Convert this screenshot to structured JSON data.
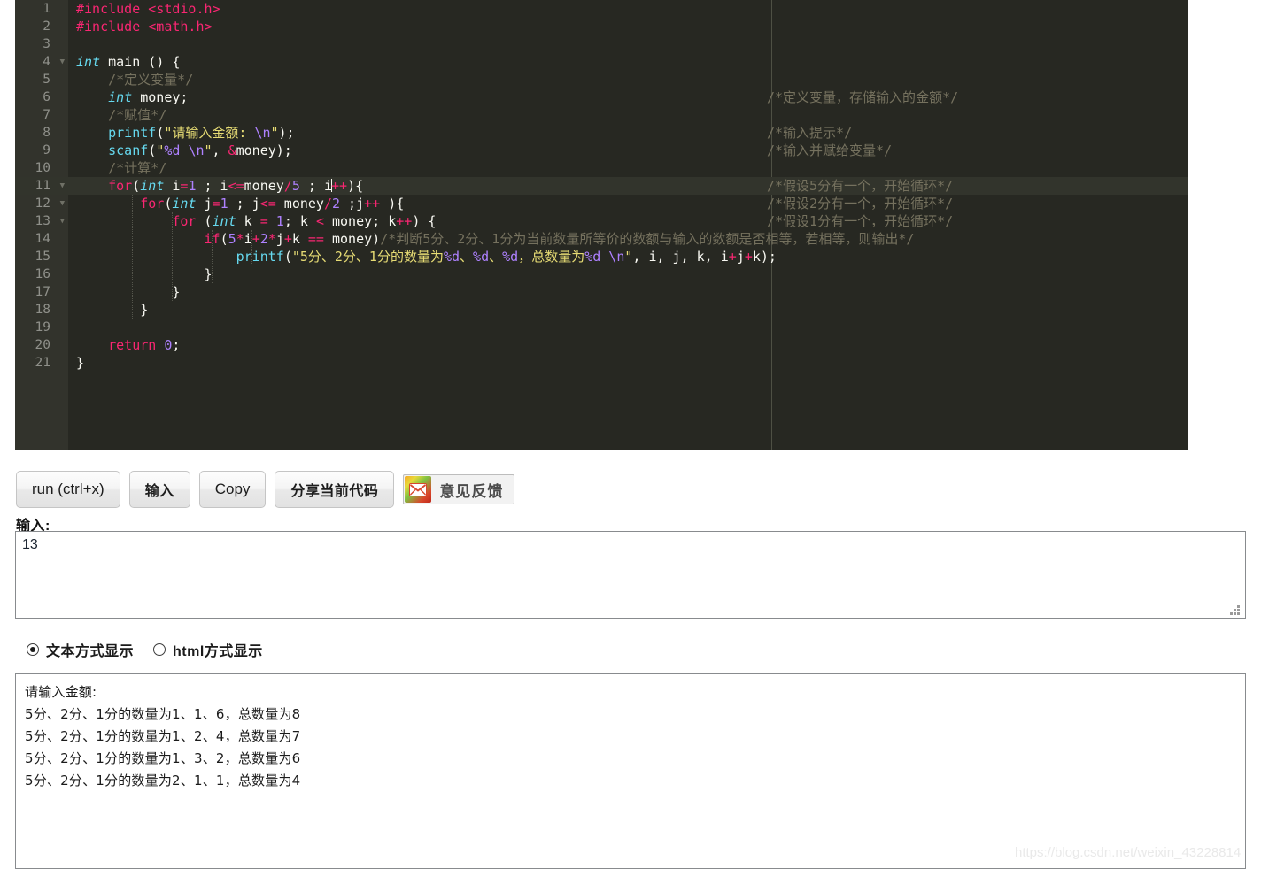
{
  "editor": {
    "lines": [
      {
        "n": 1,
        "fold": false,
        "hl": false
      },
      {
        "n": 2,
        "fold": false,
        "hl": false
      },
      {
        "n": 3,
        "fold": false,
        "hl": false
      },
      {
        "n": 4,
        "fold": true,
        "hl": false
      },
      {
        "n": 5,
        "fold": false,
        "hl": false
      },
      {
        "n": 6,
        "fold": false,
        "hl": false
      },
      {
        "n": 7,
        "fold": false,
        "hl": false
      },
      {
        "n": 8,
        "fold": false,
        "hl": false
      },
      {
        "n": 9,
        "fold": false,
        "hl": false
      },
      {
        "n": 10,
        "fold": false,
        "hl": false
      },
      {
        "n": 11,
        "fold": true,
        "hl": true
      },
      {
        "n": 12,
        "fold": true,
        "hl": false
      },
      {
        "n": 13,
        "fold": true,
        "hl": false
      },
      {
        "n": 14,
        "fold": false,
        "hl": false
      },
      {
        "n": 15,
        "fold": false,
        "hl": false
      },
      {
        "n": 16,
        "fold": false,
        "hl": false
      },
      {
        "n": 17,
        "fold": false,
        "hl": false
      },
      {
        "n": 18,
        "fold": false,
        "hl": false
      },
      {
        "n": 19,
        "fold": false,
        "hl": false
      },
      {
        "n": 20,
        "fold": false,
        "hl": false
      },
      {
        "n": 21,
        "fold": false,
        "hl": false
      }
    ],
    "code": [
      "#include <stdio.h>",
      "#include <math.h>",
      "",
      "int main () {",
      "    /*定义变量*/",
      "    int money;",
      "    /*赋值*/",
      "    printf(\"请输入金额: \\n\");",
      "    scanf(\"%d \\n\", &money);",
      "    /*计算*/",
      "    for(int i=1 ; i<=money/5 ; i++){",
      "        for(int j=1 ; j<= money/2 ;j++ ){",
      "            for (int k = 1; k < money; k++) {",
      "                if(5*i+2*j+k == money)/*判断5分、2分、1分为当前数量所等价的数额与输入的数额是否相等，若相等，则输出*/",
      "                    printf(\"5分、2分、1分的数量为%d、%d、%d，总数量为%d \\n\", i, j, k, i+j+k);",
      "                }",
      "            }",
      "        }",
      "",
      "    return 0;",
      "}"
    ],
    "side_comments": {
      "line6": "/*定义变量，存储输入的金额*/",
      "line8": "/*输入提示*/",
      "line9": "/*输入并赋给变量*/",
      "line11": "/*假设5分有一个，开始循环*/",
      "line12": "/*假设2分有一个，开始循环*/",
      "line13": "/*假设1分有一个，开始循环*/"
    },
    "colors": {
      "background": "#272822",
      "gutter": "#32332c",
      "line_highlight": "#32342c",
      "comment": "#75715e",
      "keyword": "#f92672",
      "type": "#66d9ef",
      "string": "#e6db74",
      "number": "#ae81ff",
      "plain": "#f8f8f2"
    }
  },
  "toolbar": {
    "run_label": "run (ctrl+x)",
    "input_label": "输入",
    "copy_label": "Copy",
    "share_label": "分享当前代码",
    "feedback_label": "意见反馈",
    "feedback_icon": "envelope-icon"
  },
  "input_section": {
    "label": "输入:",
    "value": "13",
    "placeholder": ""
  },
  "display_mode": {
    "options": [
      {
        "label": "文本方式显示",
        "selected": true
      },
      {
        "label": "html方式显示",
        "selected": false
      }
    ]
  },
  "output": {
    "lines": [
      "请输入金额:",
      "5分、2分、1分的数量为1、1、6，总数量为8",
      "5分、2分、1分的数量为1、2、4，总数量为7",
      "5分、2分、1分的数量为1、3、2，总数量为6",
      "5分、2分、1分的数量为2、1、1，总数量为4"
    ]
  },
  "watermark": "https://blog.csdn.net/weixin_43228814"
}
